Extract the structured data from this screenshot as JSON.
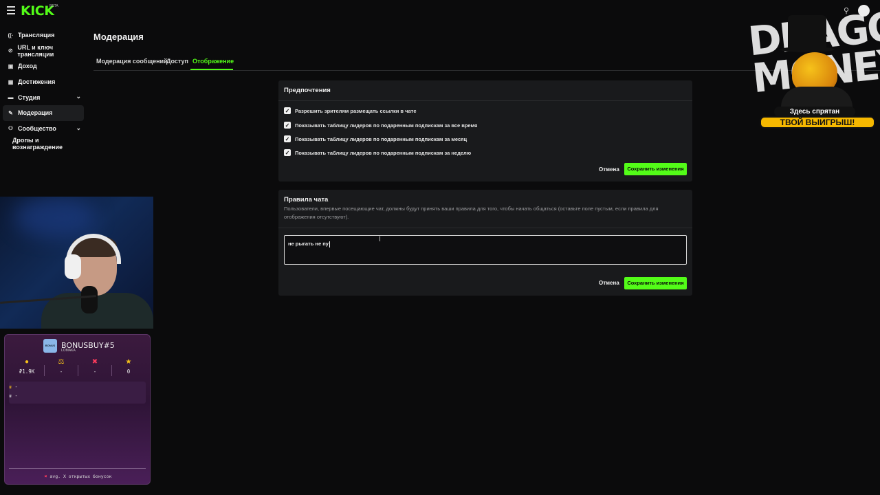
{
  "header": {
    "logo": "KICK",
    "beta": "BETA"
  },
  "sidebar": {
    "items": [
      {
        "label": "Трансляция",
        "icon": "broadcast-icon"
      },
      {
        "label": "URL и ключ трансляции",
        "icon": "link-icon"
      },
      {
        "label": "Доход",
        "icon": "wallet-icon"
      },
      {
        "label": "Достижения",
        "icon": "trophy-icon"
      },
      {
        "label": "Студия",
        "icon": "studio-icon"
      },
      {
        "label": "Модерация",
        "icon": "wrench-icon"
      },
      {
        "label": "Сообщество",
        "icon": "community-icon"
      },
      {
        "label": "Дропы и вознаграждение"
      }
    ]
  },
  "main": {
    "title": "Модерация",
    "tabs": [
      {
        "label": "Модерация сообщений"
      },
      {
        "label": "Доступ"
      },
      {
        "label": "Отображение"
      }
    ]
  },
  "preferences": {
    "title": "Предпочтения",
    "options": [
      {
        "label": "Разрешить зрителям размещать ссылки в чате",
        "checked": true
      },
      {
        "label": "Показывать таблицу лидеров по подаренным подпискам за все время",
        "checked": true
      },
      {
        "label": "Показывать таблицу лидеров по подаренным подпискам за месяц",
        "checked": true
      },
      {
        "label": "Показывать таблицу лидеров по подаренным подпискам за неделю",
        "checked": true
      }
    ],
    "cancel": "Отмена",
    "save": "Сохранить изменения"
  },
  "chat_rules": {
    "title": "Правила чата",
    "description": "Пользователи, впервые посещающие чат, должны будут принять ваши правила для того, чтобы начать общаться (оставьте поле пустым, если правила для отображения отсутствуют).",
    "value": "не рыгать не пу",
    "cancel": "Отмена",
    "save": "Сохранить изменения"
  },
  "overlay_widget": {
    "logo": "BONUS",
    "title": "BONUSBUY#5",
    "subtitle": "LOMAKA",
    "stats": [
      "₽1.9K",
      "-",
      "-",
      "0"
    ],
    "rows": [
      "-",
      "-"
    ],
    "footer_prefix": "avg. X открытых бонусок"
  },
  "promo": {
    "graffiti": "DRAGON MONEY",
    "tag1": "Здесь спрятан",
    "tag2": "ТВОЙ ВЫИГРЫШ!"
  },
  "colors": {
    "accent": "#53fc18",
    "background": "#0b0b0c",
    "card": "#191a1c"
  }
}
